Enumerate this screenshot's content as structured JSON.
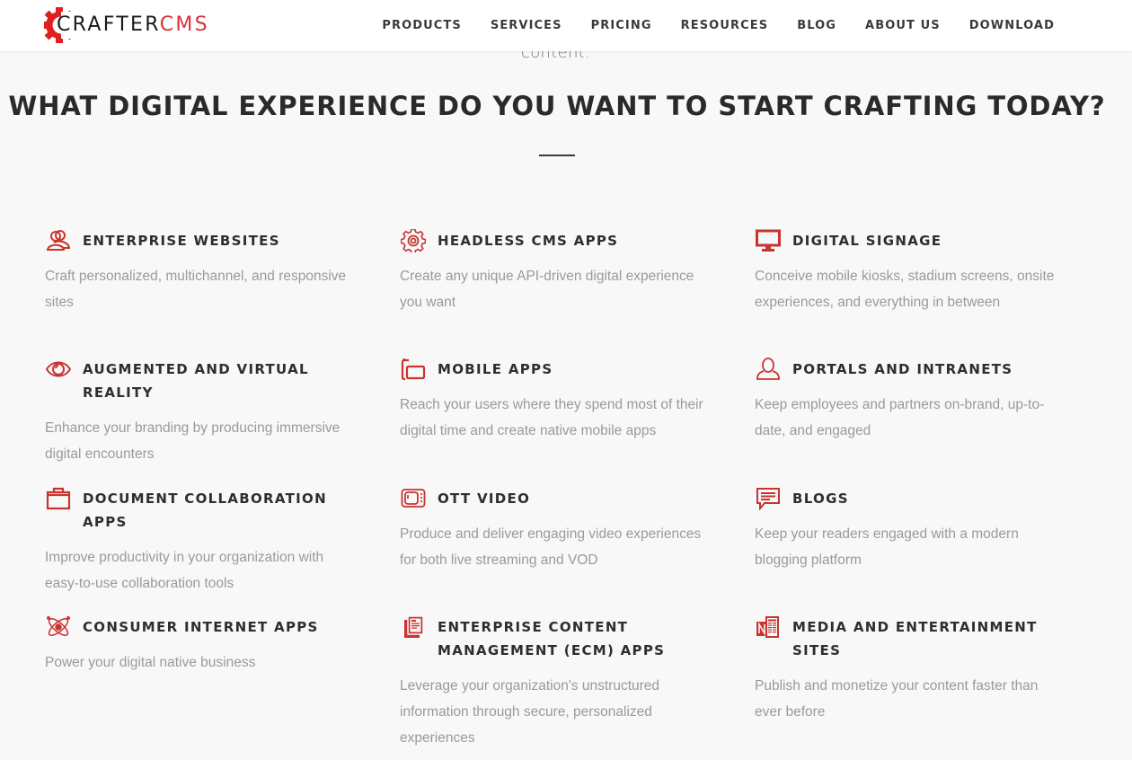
{
  "brand": {
    "name_part1": "CRAFTER",
    "name_part2": "CMS",
    "accent_color": "#d9313a"
  },
  "nav": {
    "items": [
      {
        "label": "PRODUCTS"
      },
      {
        "label": "SERVICES"
      },
      {
        "label": "PRICING"
      },
      {
        "label": "RESOURCES"
      },
      {
        "label": "BLOG"
      },
      {
        "label": "ABOUT US"
      },
      {
        "label": "DOWNLOAD"
      }
    ]
  },
  "intro_fragment": "content.",
  "section": {
    "title": "WHAT DIGITAL EXPERIENCE DO YOU WANT TO START CRAFTING TODAY?"
  },
  "experiences": [
    {
      "icon": "users-icon",
      "title": "ENTERPRISE WEBSITES",
      "description": "Craft personalized, multichannel, and responsive sites"
    },
    {
      "icon": "gear-icon",
      "title": "HEADLESS CMS APPS",
      "description": "Create any unique API-driven digital experience you want"
    },
    {
      "icon": "monitor-icon",
      "title": "DIGITAL SIGNAGE",
      "description": "Conceive mobile kiosks, stadium screens, onsite experiences, and everything in between"
    },
    {
      "icon": "eye-icon",
      "title": "AUGMENTED AND VIRTUAL REALITY",
      "description": "Enhance your branding by producing immersive digital encounters"
    },
    {
      "icon": "mobile-devices-icon",
      "title": "MOBILE APPS",
      "description": "Reach your users where they spend most of their digital time and create native mobile apps"
    },
    {
      "icon": "user-icon",
      "title": "PORTALS AND INTRANETS",
      "description": "Keep employees and partners on-brand, up-to-date, and engaged"
    },
    {
      "icon": "briefcase-icon",
      "title": "DOCUMENT COLLABORATION APPS",
      "description": "Improve productivity in your organization with easy-to-use collaboration tools"
    },
    {
      "icon": "tv-icon",
      "title": "OTT VIDEO",
      "description": "Produce and deliver engaging video experiences for both live streaming and VOD"
    },
    {
      "icon": "chat-bubble-icon",
      "title": "BLOGS",
      "description": "Keep your readers engaged with a modern blogging platform"
    },
    {
      "icon": "atom-icon",
      "title": "CONSUMER INTERNET APPS",
      "description": "Power your digital native business"
    },
    {
      "icon": "documents-icon",
      "title": "ENTERPRISE CONTENT MANAGEMENT (ECM) APPS",
      "description": "Leverage your organization's unstructured information through secure, personalized experiences"
    },
    {
      "icon": "newspaper-icon",
      "title": "MEDIA AND ENTERTAINMENT SITES",
      "description": "Publish and monetize your content faster than ever before"
    }
  ]
}
